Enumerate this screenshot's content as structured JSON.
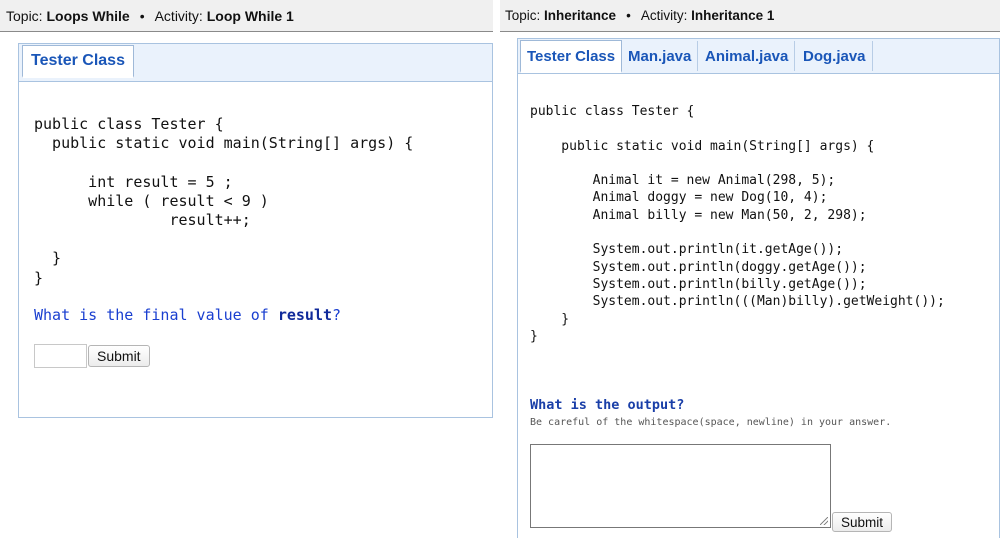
{
  "left": {
    "topic_label": "Topic:",
    "topic": "Loops While",
    "separator": "•",
    "activity_label": "Activity:",
    "activity": "Loop While 1",
    "tabs": [
      {
        "label": "Tester Class",
        "active": true
      }
    ],
    "code": "public class Tester {\n  public static void main(String[] args) {\n\n      int result = 5 ;\n      while ( result < 9 )\n               result++;\n\n  }\n}",
    "question_prefix": "What is the final value of ",
    "question_keyword": "result",
    "question_suffix": "?",
    "answer_value": "",
    "submit_label": "Submit"
  },
  "right": {
    "topic_label": "Topic:",
    "topic": "Inheritance",
    "separator": "•",
    "activity_label": "Activity:",
    "activity": "Inheritance 1",
    "tabs": [
      {
        "label": "Tester Class",
        "active": true
      },
      {
        "label": "Man.java",
        "active": false
      },
      {
        "label": "Animal.java",
        "active": false
      },
      {
        "label": "Dog.java",
        "active": false
      }
    ],
    "code": "public class Tester {\n\n    public static void main(String[] args) {\n\n        Animal it = new Animal(298, 5);\n        Animal doggy = new Dog(10, 4);\n        Animal billy = new Man(50, 2, 298);\n\n        System.out.println(it.getAge());\n        System.out.println(doggy.getAge());\n        System.out.println(billy.getAge());\n        System.out.println(((Man)billy).getWeight());\n    }\n}",
    "question": "What is the output?",
    "hint": "Be careful of the whitespace(space, newline) in your answer.",
    "answer_value": "",
    "submit_label": "Submit"
  }
}
